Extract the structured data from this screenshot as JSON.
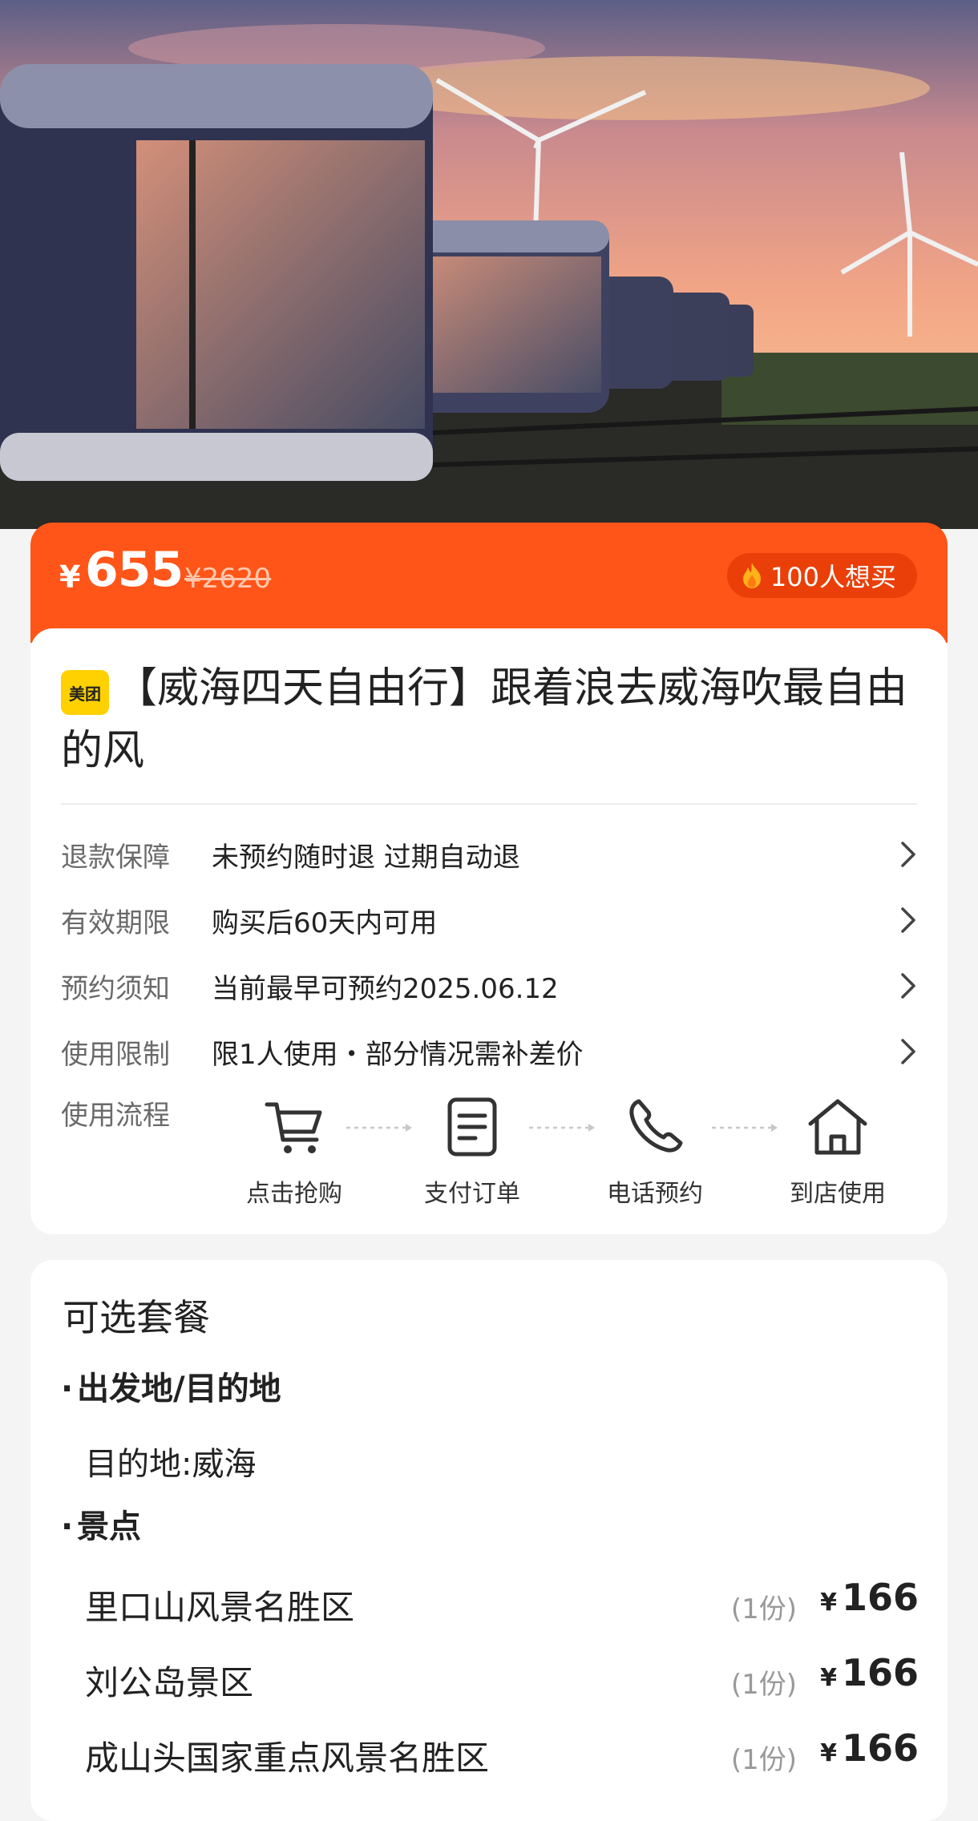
{
  "hero": {
    "image_label": "sunset capsule cabins with wind turbines"
  },
  "price": {
    "currency": "¥",
    "current": "655",
    "original": "¥2620",
    "want_count_label": "100人想买"
  },
  "deal": {
    "brand_badge": "美团",
    "title": "【威海四天自由行】跟着浪去威海吹最自由的风"
  },
  "info_rows": [
    {
      "label": "退款保障",
      "value": "未预约随时退 过期自动退"
    },
    {
      "label": "有效期限",
      "value": "购买后60天内可用"
    },
    {
      "label": "预约须知",
      "value": "当前最早可预约2025.06.12"
    },
    {
      "label": "使用限制",
      "value": "限1人使用・部分情况需补差价"
    }
  ],
  "flow": {
    "label": "使用流程",
    "steps": [
      {
        "icon": "cart-icon",
        "text": "点击抢购"
      },
      {
        "icon": "document-icon",
        "text": "支付订单"
      },
      {
        "icon": "phone-icon",
        "text": "电话预约"
      },
      {
        "icon": "home-icon",
        "text": "到店使用"
      }
    ]
  },
  "packages": {
    "title": "可选套餐",
    "sections": [
      {
        "dot": "·",
        "heading": "出发地/目的地"
      },
      {
        "dot": "·",
        "heading": "景点"
      }
    ],
    "destination": "目的地:威海",
    "items": [
      {
        "name": "里口山风景名胜区",
        "qty": "(1份)",
        "currency": "¥",
        "price": "166"
      },
      {
        "name": "刘公岛景区",
        "qty": "(1份)",
        "currency": "¥",
        "price": "166"
      },
      {
        "name": "成山头国家重点风景名胜区",
        "qty": "(1份)",
        "currency": "¥",
        "price": "166"
      }
    ]
  },
  "colors": {
    "accent": "#ff5518",
    "badge": "#ffd100"
  }
}
